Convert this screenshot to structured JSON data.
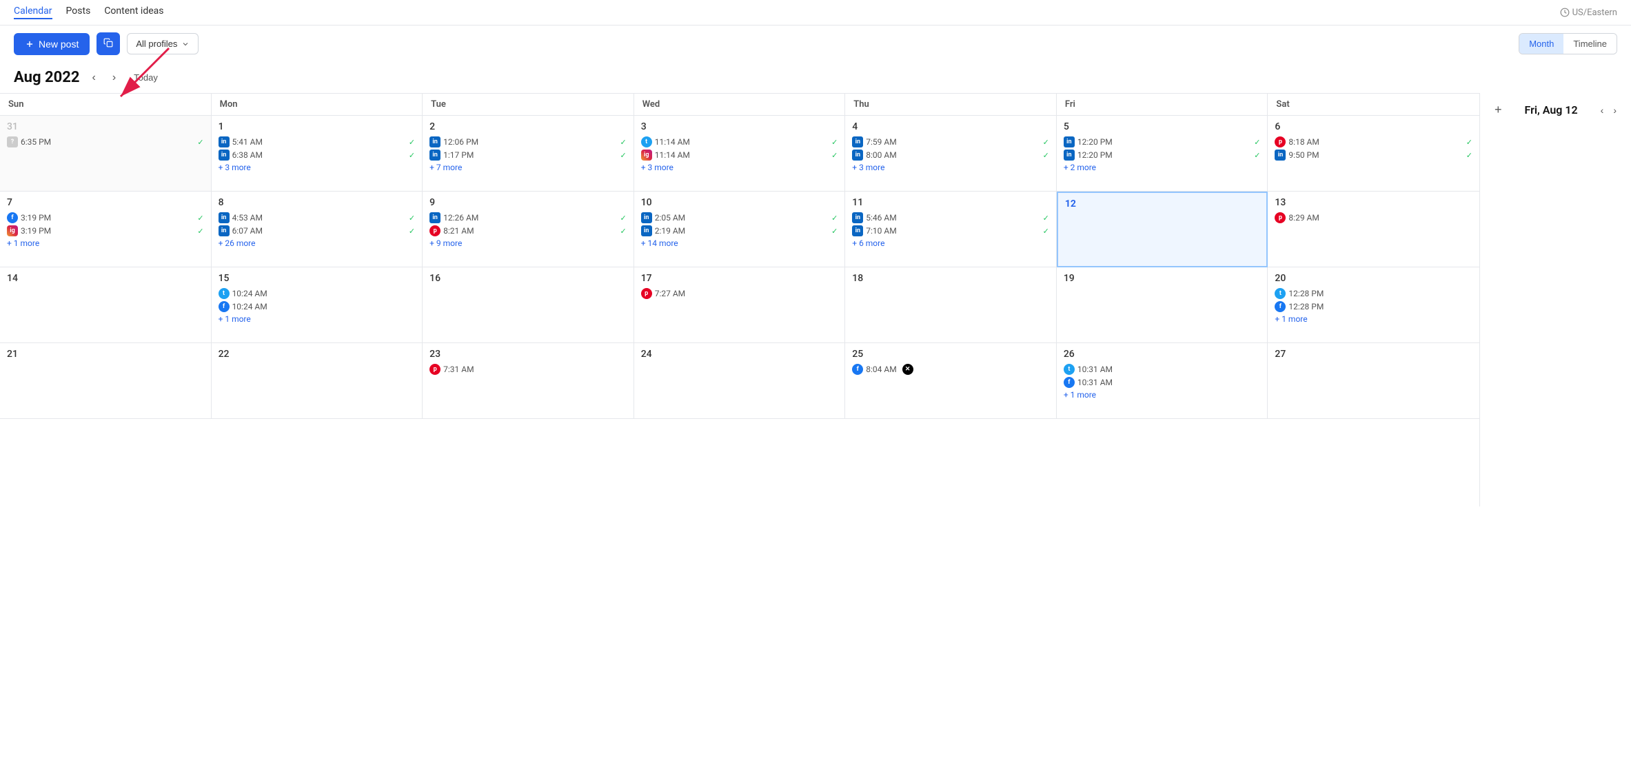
{
  "nav": {
    "items": [
      "Calendar",
      "Posts",
      "Content ideas"
    ],
    "active": "Calendar",
    "timezone": "US/Eastern"
  },
  "toolbar": {
    "new_post_label": "New post",
    "profiles_label": "All profiles",
    "view_month": "Month",
    "view_timeline": "Timeline"
  },
  "calendar": {
    "month_title": "Aug 2022",
    "today_label": "Today",
    "day_headers": [
      "Sun",
      "Mon",
      "Tue",
      "Wed",
      "Thu",
      "Fri",
      "Sat"
    ],
    "weeks": [
      {
        "days": [
          {
            "num": "31",
            "other_month": true,
            "posts": [
              {
                "icon": "ghost",
                "time": "6:35 PM",
                "check": true
              }
            ]
          },
          {
            "num": "1",
            "posts": [
              {
                "icon": "li",
                "time": "5:41 AM",
                "check": true
              },
              {
                "icon": "li",
                "time": "6:38 AM",
                "check": true
              }
            ],
            "more": "+ 3 more"
          },
          {
            "num": "2",
            "posts": [
              {
                "icon": "li",
                "time": "12:06 PM",
                "check": true
              },
              {
                "icon": "li",
                "time": "1:17 PM",
                "check": true
              }
            ],
            "more": "+ 7 more"
          },
          {
            "num": "3",
            "posts": [
              {
                "icon": "tw",
                "time": "11:14 AM",
                "check": true
              },
              {
                "icon": "ig",
                "time": "11:14 AM",
                "check": true
              }
            ],
            "more": "+ 3 more"
          },
          {
            "num": "4",
            "posts": [
              {
                "icon": "li",
                "time": "7:59 AM",
                "check": true
              },
              {
                "icon": "li",
                "time": "8:00 AM",
                "check": true
              }
            ],
            "more": "+ 3 more"
          },
          {
            "num": "5",
            "posts": [
              {
                "icon": "li",
                "time": "12:20 PM",
                "check": true
              },
              {
                "icon": "li",
                "time": "12:20 PM",
                "check": true
              }
            ],
            "more": "+ 2 more"
          },
          {
            "num": "6",
            "posts": [
              {
                "icon": "pi",
                "time": "8:18 AM",
                "check": true
              },
              {
                "icon": "li",
                "time": "9:50 PM",
                "check": true
              }
            ]
          }
        ]
      },
      {
        "days": [
          {
            "num": "7",
            "posts": [
              {
                "icon": "fb",
                "time": "3:19 PM",
                "check": true
              },
              {
                "icon": "ig",
                "time": "3:19 PM",
                "check": true
              }
            ],
            "more": "+ 1 more"
          },
          {
            "num": "8",
            "posts": [
              {
                "icon": "li",
                "time": "4:53 AM",
                "check": true
              },
              {
                "icon": "li",
                "time": "6:07 AM",
                "check": true
              }
            ],
            "more": "+ 26 more"
          },
          {
            "num": "9",
            "posts": [
              {
                "icon": "li",
                "time": "12:26 AM",
                "check": true
              },
              {
                "icon": "pi",
                "time": "8:21 AM",
                "check": true
              }
            ],
            "more": "+ 9 more"
          },
          {
            "num": "10",
            "posts": [
              {
                "icon": "li",
                "time": "2:05 AM",
                "check": true
              },
              {
                "icon": "li",
                "time": "2:19 AM",
                "check": true
              }
            ],
            "more": "+ 14 more"
          },
          {
            "num": "11",
            "posts": [
              {
                "icon": "li",
                "time": "5:46 AM",
                "check": true
              },
              {
                "icon": "li",
                "time": "7:10 AM",
                "check": true
              }
            ],
            "more": "+ 6 more"
          },
          {
            "num": "12",
            "today": true,
            "posts": []
          },
          {
            "num": "13",
            "posts": [
              {
                "icon": "pi",
                "time": "8:29 AM",
                "check": false
              }
            ]
          }
        ]
      },
      {
        "days": [
          {
            "num": "14",
            "posts": []
          },
          {
            "num": "15",
            "posts": [
              {
                "icon": "tw",
                "time": "10:24 AM",
                "check": false
              },
              {
                "icon": "fb",
                "time": "10:24 AM",
                "check": false
              }
            ],
            "more": "+ 1 more"
          },
          {
            "num": "16",
            "posts": []
          },
          {
            "num": "17",
            "posts": [
              {
                "icon": "pi",
                "time": "7:27 AM",
                "check": false
              }
            ]
          },
          {
            "num": "18",
            "posts": []
          },
          {
            "num": "19",
            "posts": []
          },
          {
            "num": "20",
            "posts": [
              {
                "icon": "tw",
                "time": "12:28 PM",
                "check": false
              },
              {
                "icon": "fb",
                "time": "12:28 PM",
                "check": false
              }
            ],
            "more": "+ 1 more"
          }
        ]
      },
      {
        "days": [
          {
            "num": "21",
            "posts": []
          },
          {
            "num": "22",
            "posts": []
          },
          {
            "num": "23",
            "posts": [
              {
                "icon": "pi",
                "time": "7:31 AM",
                "check": false
              }
            ]
          },
          {
            "num": "24",
            "posts": []
          },
          {
            "num": "25",
            "posts": [
              {
                "icon": "fb",
                "time": "8:04 AM",
                "check": false
              }
            ],
            "x_badge": true
          },
          {
            "num": "26",
            "posts": [
              {
                "icon": "tw",
                "time": "10:31 AM",
                "check": false
              },
              {
                "icon": "fb",
                "time": "10:31 AM",
                "check": false
              }
            ],
            "more": "+ 1 more"
          },
          {
            "num": "27",
            "posts": []
          }
        ]
      }
    ]
  },
  "sidebar": {
    "date_label": "Fri, Aug 12",
    "add_icon": "+",
    "prev_icon": "‹",
    "next_icon": "›"
  },
  "icons": {
    "li": "in",
    "tw": "t",
    "fb": "f",
    "ig": "ig",
    "pi": "p",
    "x": "x",
    "ghost": "?"
  }
}
